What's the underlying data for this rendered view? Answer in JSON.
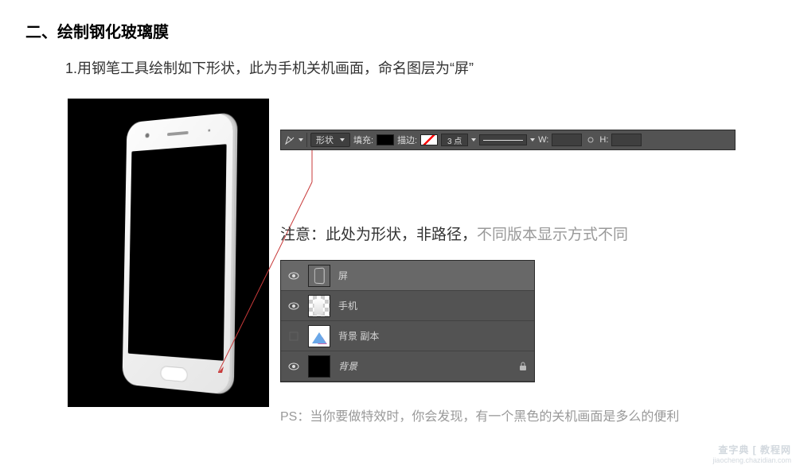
{
  "section_title": "二、绘制钢化玻璃膜",
  "step": "1.用钢笔工具绘制如下形状，此为手机关机画面，命名图层为“屏”",
  "options_bar": {
    "tool_icon": "pen-icon",
    "mode": "形状",
    "fill_label": "填充:",
    "stroke_label": "描边:",
    "stroke_width": "3 点",
    "w_label": "W:",
    "h_label": "H:"
  },
  "note": {
    "black": "注意：此处为形状，非路径，",
    "gray": "不同版本显示方式不同"
  },
  "layers": [
    {
      "name": "屏",
      "thumb": "shape",
      "visible": true,
      "selected": true,
      "locked": false,
      "italic": false
    },
    {
      "name": "手机",
      "thumb": "checker",
      "visible": true,
      "selected": false,
      "locked": false,
      "italic": false
    },
    {
      "name": "背景 副本",
      "thumb": "mask",
      "visible": false,
      "selected": false,
      "locked": false,
      "italic": false
    },
    {
      "name": "背景",
      "thumb": "black",
      "visible": true,
      "selected": false,
      "locked": true,
      "italic": true
    }
  ],
  "ps_note": "PS：当你要做特效时，你会发现，有一个黑色的关机画面是多么的便利",
  "watermark": {
    "main": "查字典 [ 教程网",
    "sub": "jiaocheng.chazidian.com"
  }
}
